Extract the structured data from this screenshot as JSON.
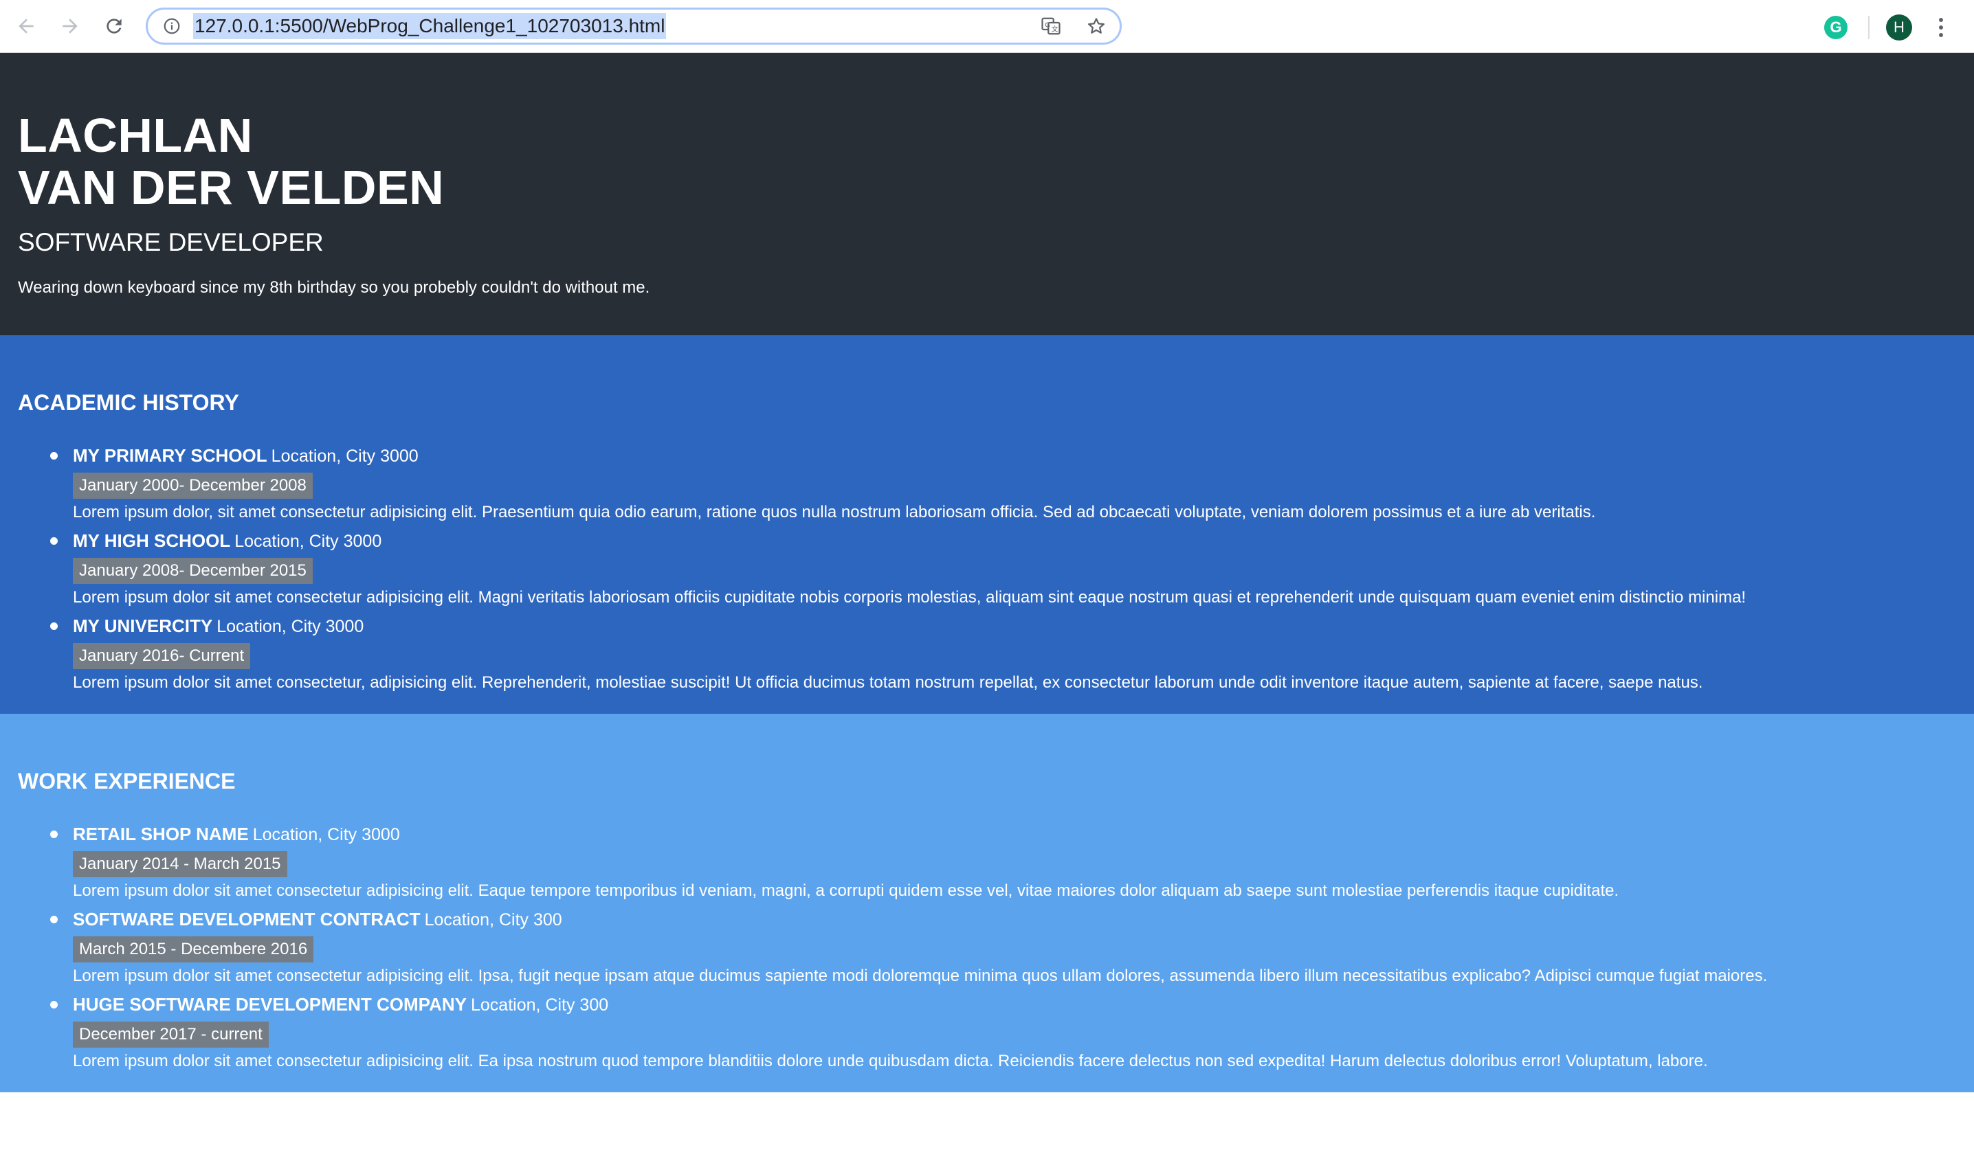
{
  "browser": {
    "url": "127.0.0.1:5500/WebProg_Challenge1_102703013.html",
    "profile_initial": "H",
    "extension_label": "G"
  },
  "hero": {
    "name_line1": "LACHLAN",
    "name_line2": "VAN DER VELDEN",
    "role": "SOFTWARE DEVELOPER",
    "tagline": "Wearing down keyboard since my 8th birthday so you probebly couldn't do without me."
  },
  "academic": {
    "heading": "ACADEMIC HISTORY",
    "items": [
      {
        "title": "MY PRIMARY SCHOOL",
        "location": "Location, City 3000",
        "dates": "January 2000- December 2008",
        "description": "Lorem ipsum dolor, sit amet consectetur adipisicing elit. Praesentium quia odio earum, ratione quos nulla nostrum laboriosam officia. Sed ad obcaecati voluptate, veniam dolorem possimus et a iure ab veritatis."
      },
      {
        "title": "MY HIGH SCHOOL",
        "location": "Location, City 3000",
        "dates": "January 2008- December 2015",
        "description": "Lorem ipsum dolor sit amet consectetur adipisicing elit. Magni veritatis laboriosam officiis cupiditate nobis corporis molestias, aliquam sint eaque nostrum quasi et reprehenderit unde quisquam quam eveniet enim distinctio minima!"
      },
      {
        "title": "MY UNIVERCITY",
        "location": "Location, City 3000",
        "dates": "January 2016- Current",
        "description": "Lorem ipsum dolor sit amet consectetur, adipisicing elit. Reprehenderit, molestiae suscipit! Ut officia ducimus totam nostrum repellat, ex consectetur laborum unde odit inventore itaque autem, sapiente at facere, saepe natus."
      }
    ]
  },
  "work": {
    "heading": "WORK EXPERIENCE",
    "items": [
      {
        "title": "RETAIL SHOP NAME",
        "location": "Location, City 3000",
        "dates": "January 2014 - March 2015",
        "description": "Lorem ipsum dolor sit amet consectetur adipisicing elit. Eaque tempore temporibus id veniam, magni, a corrupti quidem esse vel, vitae maiores dolor aliquam ab saepe sunt molestiae perferendis itaque cupiditate."
      },
      {
        "title": "SOFTWARE DEVELOPMENT CONTRACT",
        "location": "Location, City 300",
        "dates": "March 2015 - Decembere 2016",
        "description": "Lorem ipsum dolor sit amet consectetur adipisicing elit. Ipsa, fugit neque ipsam atque ducimus sapiente modi doloremque minima quos ullam dolores, assumenda libero illum necessitatibus explicabo? Adipisci cumque fugiat maiores."
      },
      {
        "title": "HUGE SOFTWARE DEVELOPMENT COMPANY",
        "location": "Location, City 300",
        "dates": "December 2017 - current",
        "description": "Lorem ipsum dolor sit amet consectetur adipisicing elit. Ea ipsa nostrum quod tempore blanditiis dolore unde quibusdam dicta. Reiciendis facere delectus non sed expedita! Harum delectus doloribus error! Voluptatum, labore."
      }
    ]
  },
  "colors": {
    "hero_bg": "#282e36",
    "academic_bg": "#2d66bf",
    "work_bg": "#5ca3ed",
    "date_badge_bg": "#747c85"
  }
}
